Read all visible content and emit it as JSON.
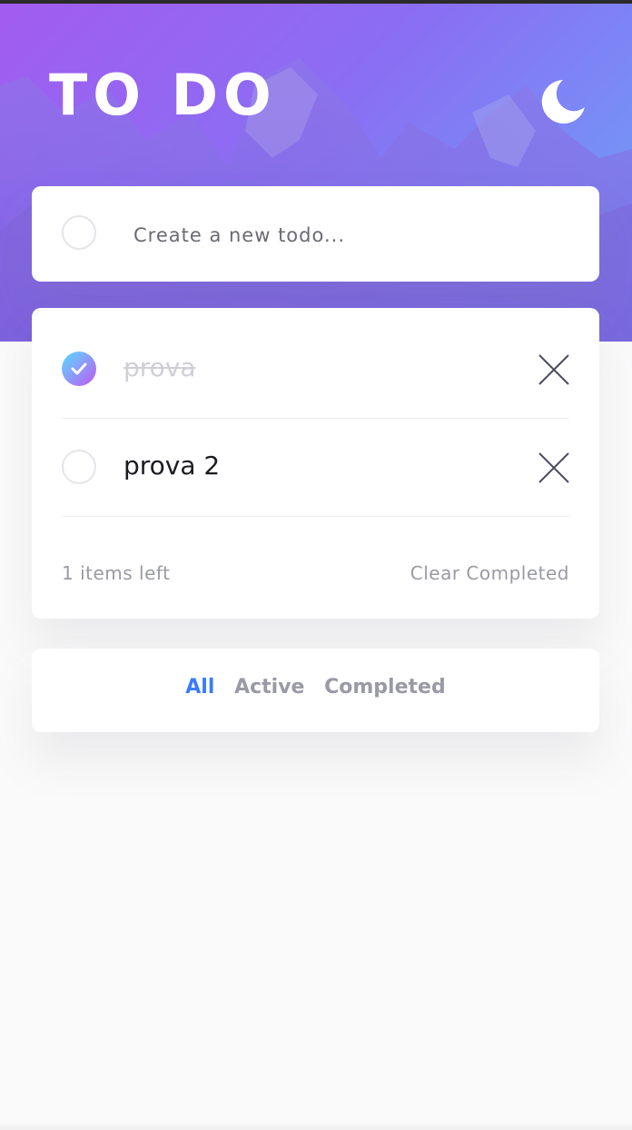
{
  "header": {
    "title": "TO DO",
    "theme_icon": "moon-icon"
  },
  "new_todo": {
    "placeholder": "Create a new todo..."
  },
  "todos": [
    {
      "text": "prova",
      "completed": true
    },
    {
      "text": "prova 2",
      "completed": false
    }
  ],
  "footer": {
    "items_left": "1 items left",
    "clear_label": "Clear Completed"
  },
  "filters": {
    "all": "All",
    "active": "Active",
    "completed": "Completed",
    "selected": "All"
  },
  "colors": {
    "accent": "#3a7bfd",
    "check_gradient_start": "#57ddff",
    "check_gradient_end": "#c058f3",
    "muted_text": "#9a9aa6"
  }
}
